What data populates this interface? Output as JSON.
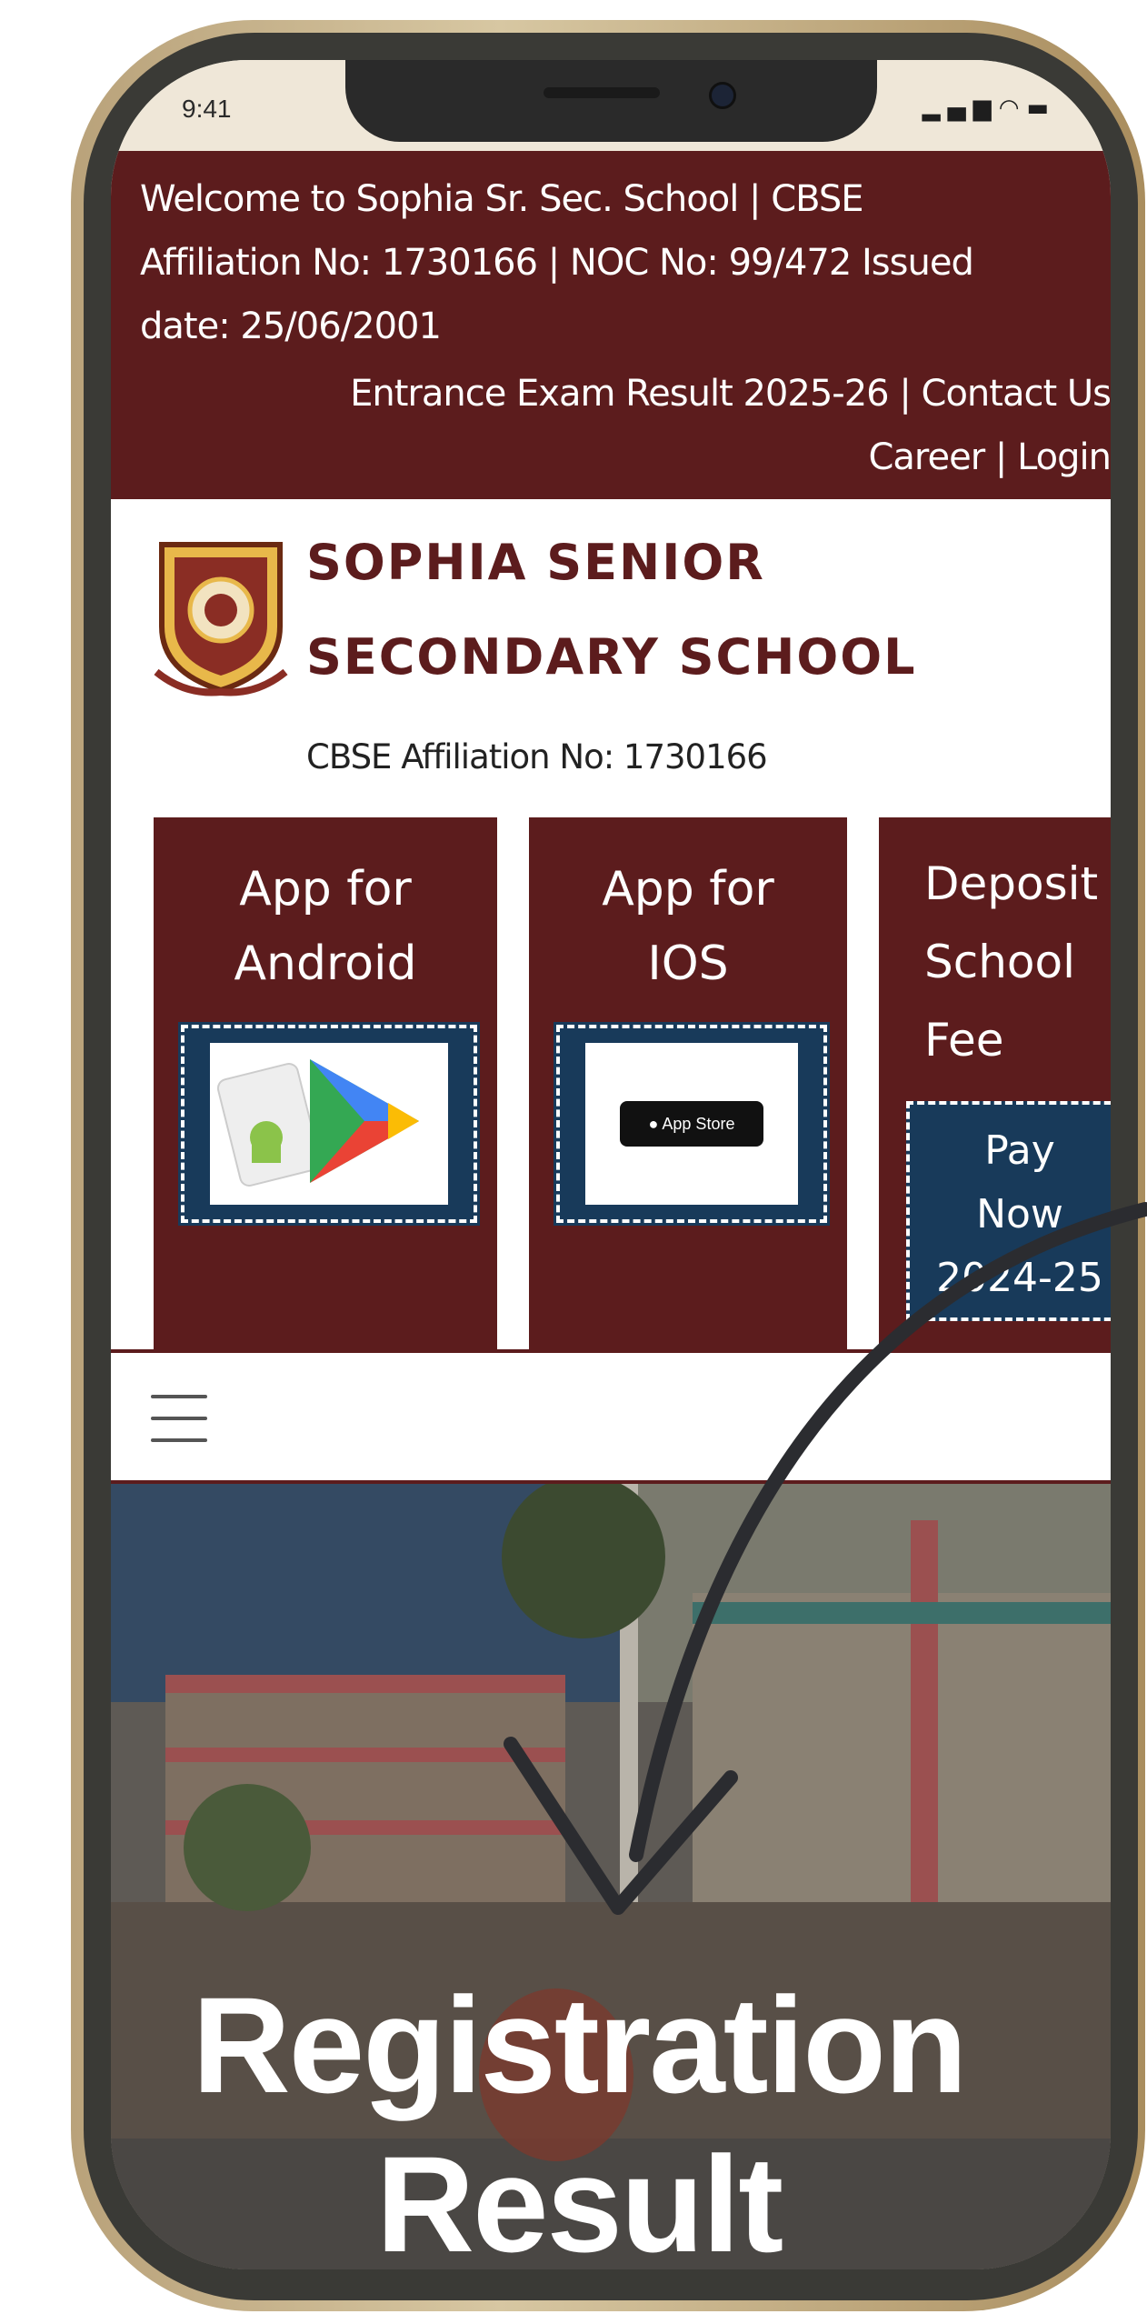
{
  "status_bar": {
    "time": "9:41",
    "icons": "signal-icon wifi-icon battery-icon"
  },
  "info_bar": {
    "welcome": "Welcome to Sophia Sr. Sec. School | CBSE\nAffiliation No: 1730166 | NOC No: 99/472 Issued\ndate: 25/06/2001",
    "links_row1": [
      "Entrance Exam Result 2025-26",
      "|",
      "Contact Us"
    ],
    "links_row2": [
      "Career",
      "|",
      "Login"
    ]
  },
  "header": {
    "school_name": "SOPHIA SENIOR\nSECONDARY SCHOOL",
    "affiliation": "CBSE Affiliation No: 1730166"
  },
  "cards": [
    {
      "title": "App for\nAndroid",
      "badge": "google-play-icon"
    },
    {
      "title": "App for\nIOS",
      "badge": "app-store-icon",
      "badge_text": "App Store"
    },
    {
      "title": "Deposit\nSchool\nFee",
      "button": "Pay\nNow\n2024-25"
    }
  ],
  "menu": {
    "icon": "hamburger-icon"
  },
  "hero": {
    "title": "Registration\nResult"
  },
  "colors": {
    "maroon": "#5c1c1d",
    "navy": "#183a5a",
    "white": "#ffffff"
  }
}
